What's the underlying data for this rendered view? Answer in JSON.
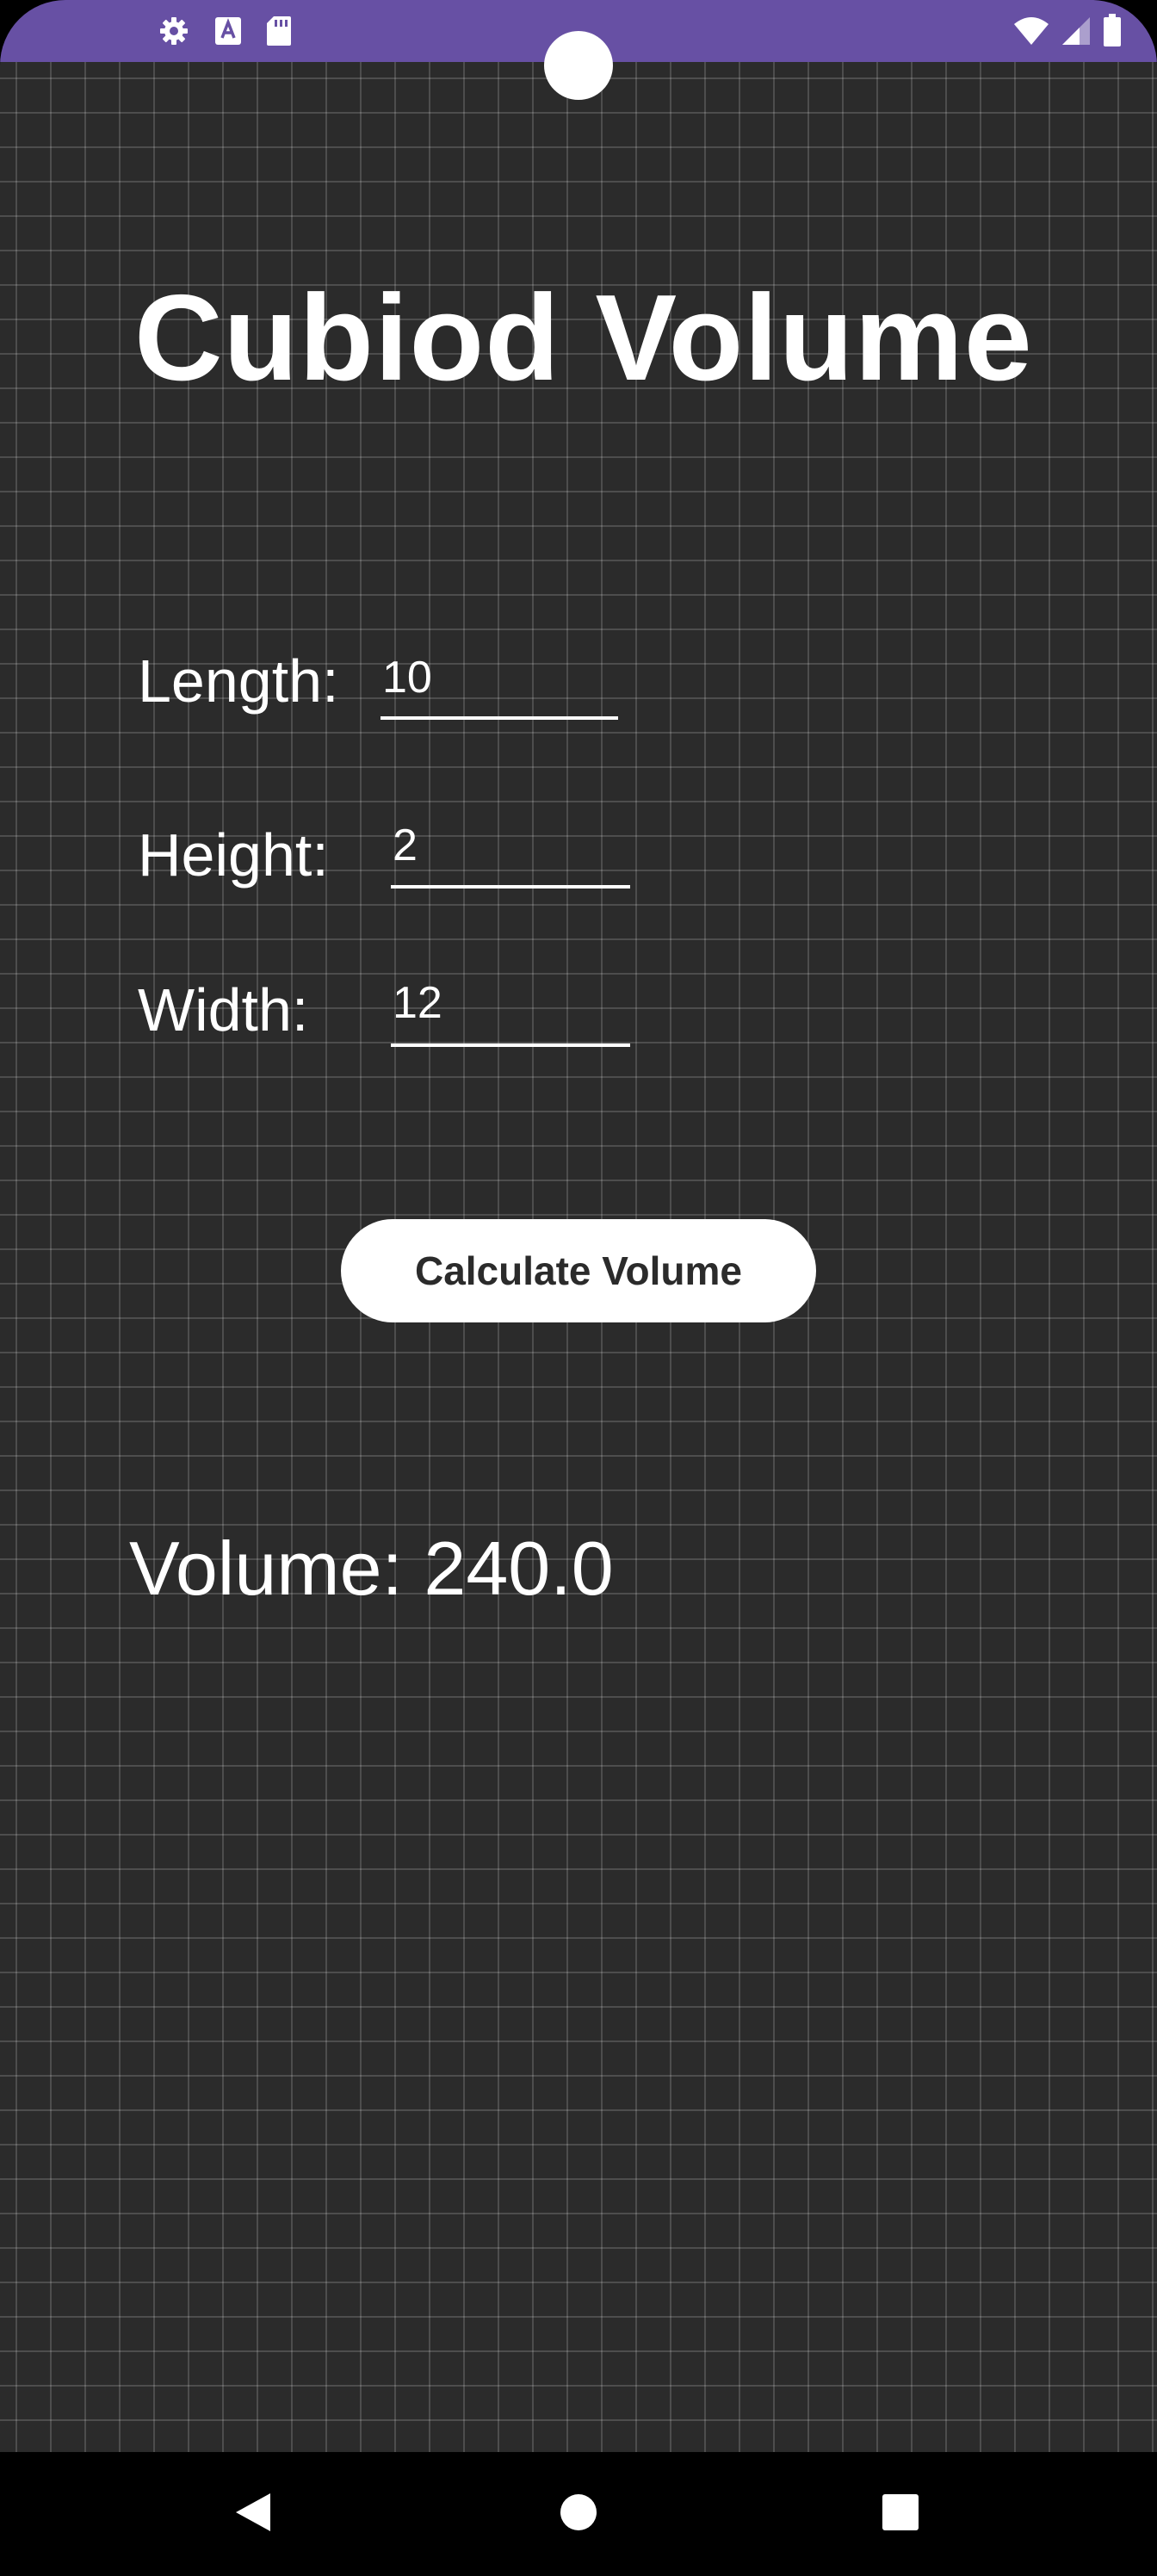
{
  "app": {
    "title": "Cubiod Volume"
  },
  "status_bar": {
    "background": "#6750a4",
    "left_icons": [
      "settings-icon",
      "keyboard-a-icon",
      "sd-card-icon"
    ],
    "right_icons": [
      "wifi-icon",
      "cellular-signal-icon",
      "battery-icon"
    ]
  },
  "form": {
    "length": {
      "label": "Length:",
      "value": "10"
    },
    "height": {
      "label": "Height:",
      "value": "2"
    },
    "width": {
      "label": "Width:",
      "value": "12"
    }
  },
  "actions": {
    "calculate_label": "Calculate Volume"
  },
  "result": {
    "text": "Volume: 240.0"
  },
  "nav_bar": {
    "buttons": [
      "back-icon",
      "home-icon",
      "recents-icon"
    ]
  },
  "colors": {
    "status_bar": "#6750a4",
    "background": "#2b2b2b",
    "grid_lines": "#4a4a4a",
    "text": "#ffffff",
    "button_bg": "#ffffff",
    "button_text": "#2b2b2b"
  }
}
